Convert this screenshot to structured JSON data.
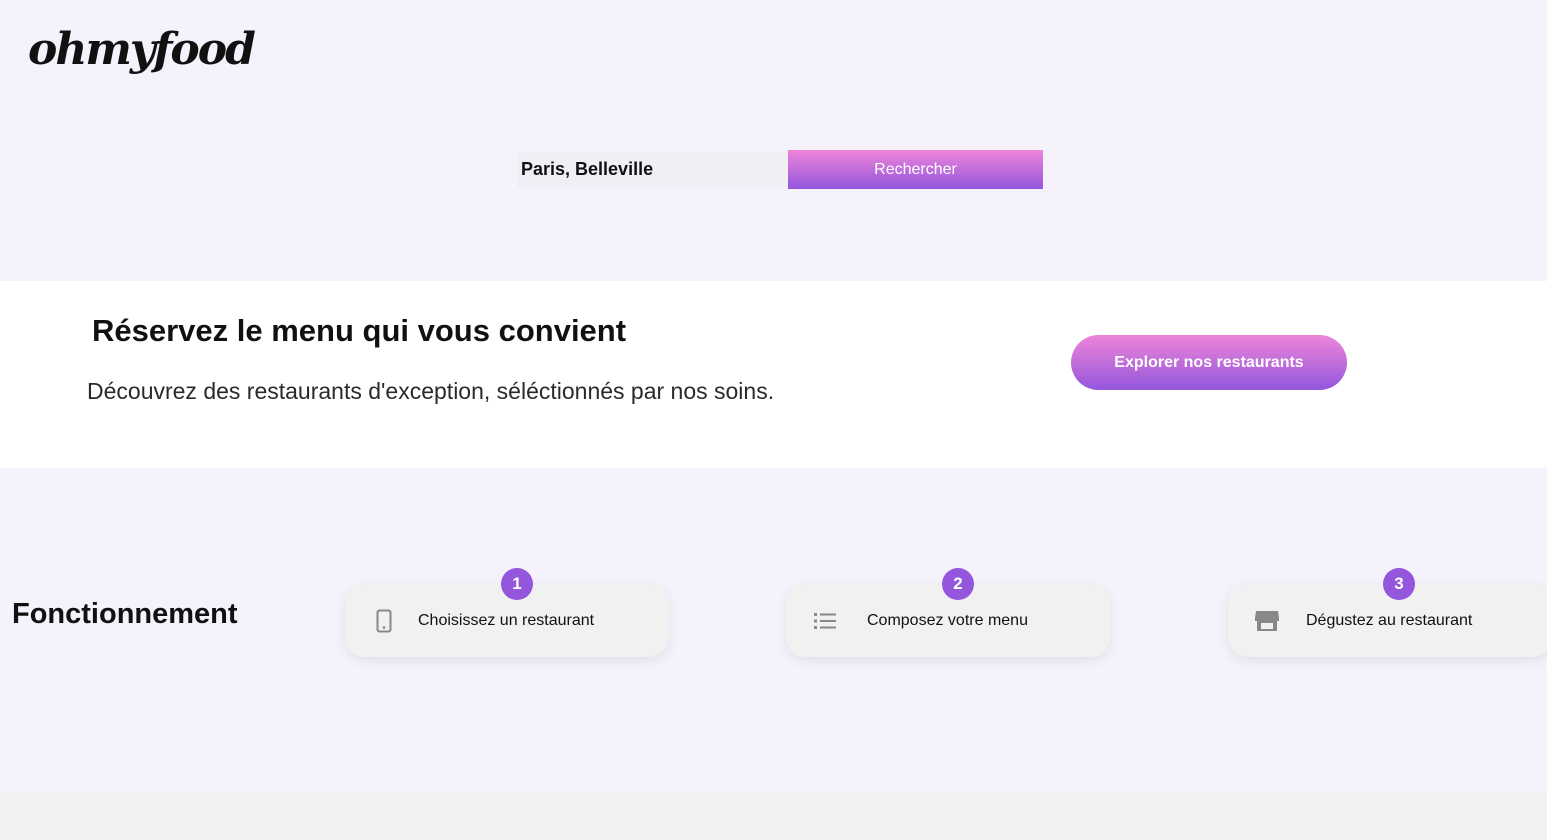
{
  "brand": {
    "logo_text": "ohmyfood"
  },
  "search": {
    "location_value": "Paris, Belleville",
    "button_label": "Rechercher"
  },
  "hero": {
    "title": "Réservez le menu qui vous convient",
    "subtitle": "Découvrez des restaurants d'exception, séléctionnés par nos soins.",
    "cta_label": "Explorer nos restaurants"
  },
  "how_it_works": {
    "title": "Fonctionnement",
    "steps": [
      {
        "number": "1",
        "icon": "smartphone-icon",
        "label": "Choisissez un restaurant"
      },
      {
        "number": "2",
        "icon": "list-icon",
        "label": "Composez votre menu"
      },
      {
        "number": "3",
        "icon": "storefront-icon",
        "label": "Dégustez au restaurant"
      }
    ]
  },
  "colors": {
    "gradient_top": "#ee85d9",
    "gradient_bottom": "#9356dc",
    "accent_purple": "#9356dc",
    "section_background": "#f5f2fc"
  }
}
